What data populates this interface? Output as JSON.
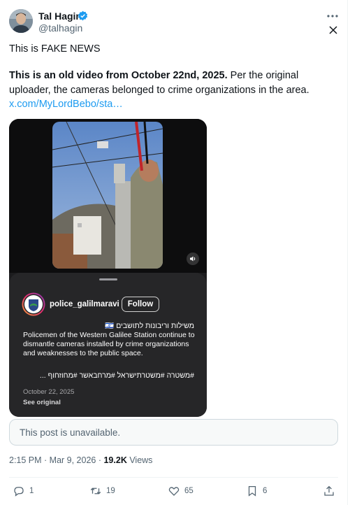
{
  "author": {
    "name": "Tal Hagin",
    "handle": "@talhagin"
  },
  "tweet": {
    "line1": "This is FAKE NEWS",
    "line2_bold": "This is an old video from October 22nd, 2025.",
    "line2_rest": "  Per the original",
    "line3": "uploader, the cameras belonged to crime organizations in the area.",
    "link": "x.com/MyLordBebo/sta…"
  },
  "embed": {
    "username": "police_galilmaravi",
    "follow_label": "Follow",
    "hebrew_line1": "משילות וריבונות לתושבים 🇮🇱",
    "caption": "Policemen of the Western Galilee Station continue to dismantle cameras installed by crime organizations and weaknesses to the public space.",
    "hashtags": "#משטרה #משטרתישראל #מרחבאשר #מחוזחוף ...",
    "date": "October 22, 2025",
    "see_original": "See original"
  },
  "unavailable_text": "This post is unavailable.",
  "meta": {
    "time": "2:15 PM · Mar 9, 2026 · ",
    "views_count": "19.2K",
    "views_label": " Views"
  },
  "actions": {
    "replies": "1",
    "reposts": "19",
    "likes": "65",
    "bookmarks": "6"
  },
  "colors": {
    "accent": "#1d9bf0",
    "muted": "#536471",
    "text": "#0f1419"
  }
}
